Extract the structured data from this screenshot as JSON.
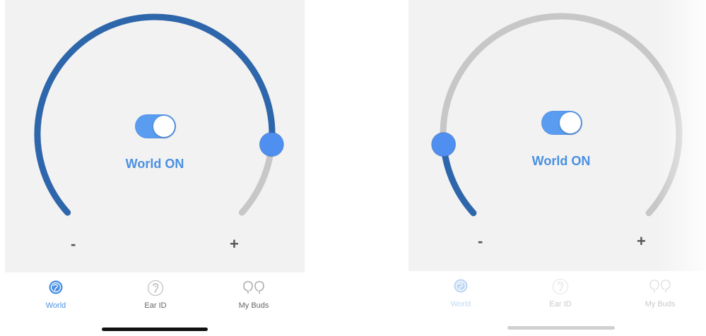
{
  "colors": {
    "arc_active": "#2e66ab",
    "arc_track": "#c7c7c7",
    "handle": "#4f8ff0",
    "toggle_on": "#5a9cf0",
    "label": "#4a90e2"
  },
  "screens": [
    {
      "dial_level": 0.86,
      "toggle_on": true,
      "mode_label": "World ON",
      "minus": "-",
      "plus": "+",
      "tabs": [
        {
          "label": "World",
          "icon": "globe-icon",
          "active": true
        },
        {
          "label": "Ear ID",
          "icon": "ear-icon",
          "active": false
        },
        {
          "label": "My Buds",
          "icon": "earbuds-icon",
          "active": false
        }
      ]
    },
    {
      "dial_level": 0.14,
      "toggle_on": true,
      "mode_label": "World ON",
      "minus": "-",
      "plus": "+",
      "tabs": [
        {
          "label": "World",
          "icon": "globe-icon",
          "active": true
        },
        {
          "label": "Ear ID",
          "icon": "ear-icon",
          "active": false
        },
        {
          "label": "My Buds",
          "icon": "earbuds-icon",
          "active": false
        }
      ]
    }
  ]
}
